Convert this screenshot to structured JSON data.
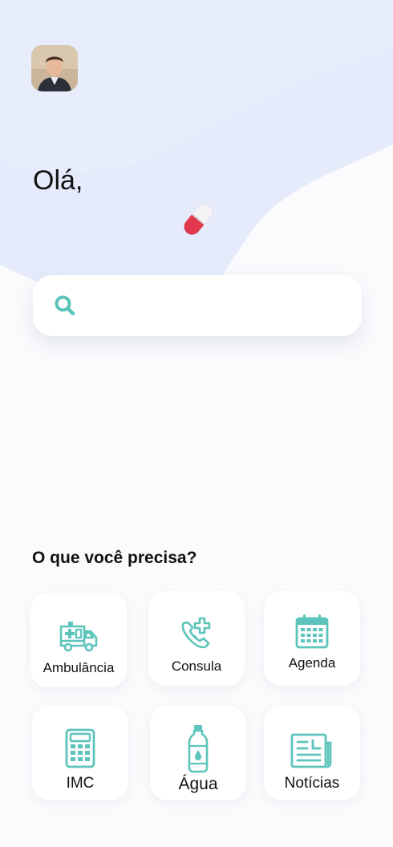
{
  "header": {
    "greeting": "Olá,"
  },
  "search": {
    "placeholder": ""
  },
  "services": {
    "title": "O que você precisa?",
    "items": [
      {
        "label": "Ambulância",
        "icon": "ambulance-icon"
      },
      {
        "label": "Consula",
        "icon": "phone-medical-icon"
      },
      {
        "label": "Agenda",
        "icon": "calendar-icon"
      },
      {
        "label": "IMC",
        "icon": "calculator-icon"
      },
      {
        "label": "Água",
        "icon": "water-bottle-icon"
      },
      {
        "label": "Notícias",
        "icon": "newspaper-icon"
      }
    ]
  },
  "colors": {
    "accent": "#5cc4bb",
    "background_blob": "#e6ebfb",
    "pill_red": "#e2384d"
  }
}
